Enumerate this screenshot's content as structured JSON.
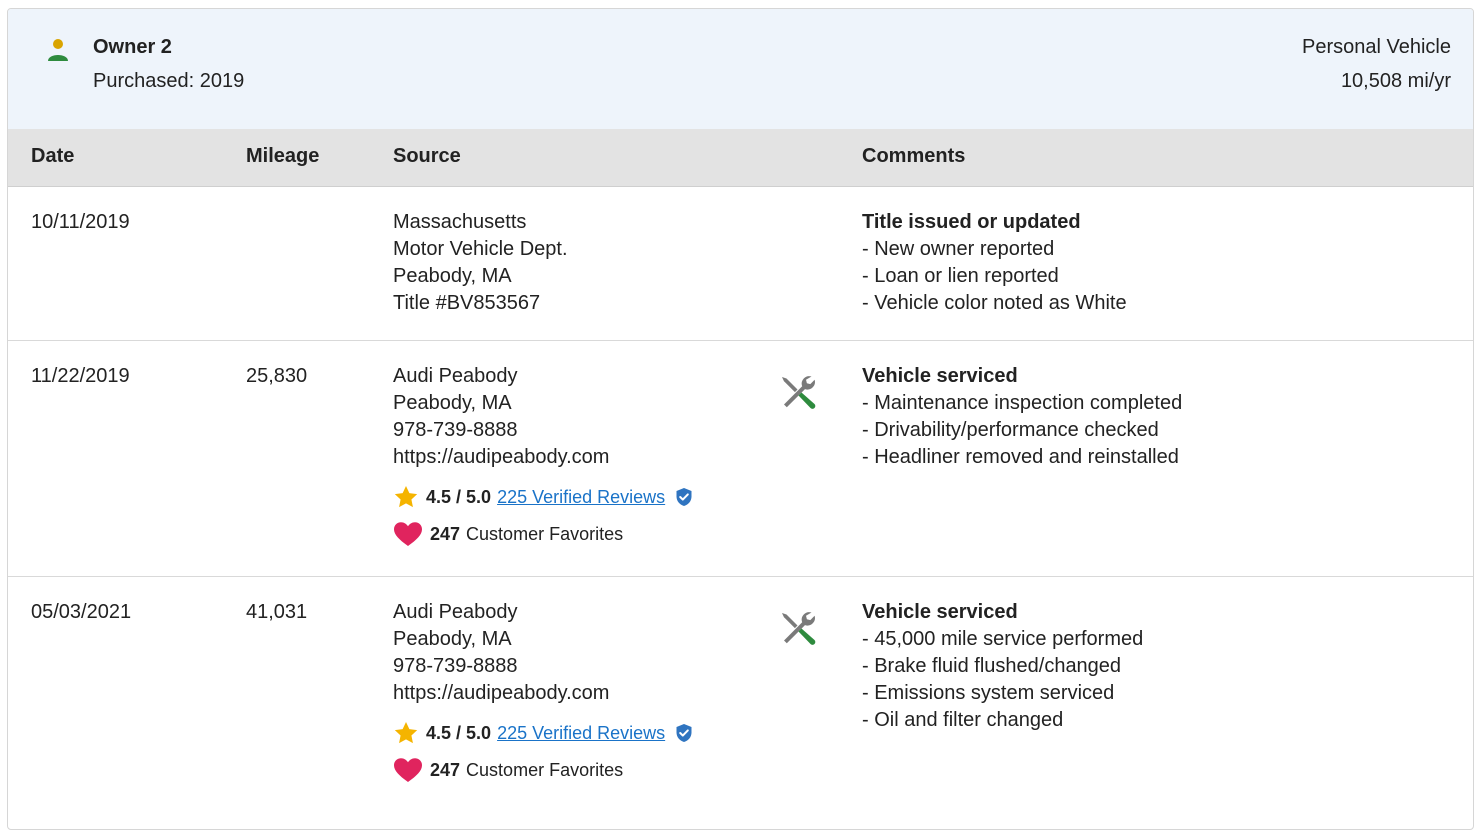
{
  "owner": {
    "name": "Owner 2",
    "purchased": "Purchased: 2019",
    "use_type": "Personal Vehicle",
    "miles_per_year": "10,508 mi/yr"
  },
  "columns": {
    "date": "Date",
    "mileage": "Mileage",
    "source": "Source",
    "comments": "Comments"
  },
  "records": [
    {
      "date": "10/11/2019",
      "mileage": "",
      "source": [
        "Massachusetts",
        "Motor Vehicle Dept.",
        "Peabody, MA",
        "Title #BV853567"
      ],
      "comment_title": "Title issued or updated",
      "comments": [
        "- New owner reported",
        "- Loan or lien reported",
        "- Vehicle color noted as White"
      ]
    },
    {
      "date": "11/22/2019",
      "mileage": "25,830",
      "source": [
        "Audi Peabody",
        "Peabody, MA",
        "978-739-8888",
        "https://audipeabody.com"
      ],
      "rating": "4.5 / 5.0",
      "reviews_link": "225 Verified Reviews",
      "favorites_count": "247",
      "favorites_label": "Customer Favorites",
      "comment_title": "Vehicle serviced",
      "comments": [
        "- Maintenance inspection completed",
        "- Drivability/performance checked",
        "- Headliner removed and reinstalled"
      ]
    },
    {
      "date": "05/03/2021",
      "mileage": "41,031",
      "source": [
        "Audi Peabody",
        "Peabody, MA",
        "978-739-8888",
        "https://audipeabody.com"
      ],
      "rating": "4.5 / 5.0",
      "reviews_link": "225 Verified Reviews",
      "favorites_count": "247",
      "favorites_label": "Customer Favorites",
      "comment_title": "Vehicle serviced",
      "comments": [
        "- 45,000 mile service performed",
        "- Brake fluid flushed/changed",
        "- Emissions system serviced",
        "- Oil and filter changed"
      ]
    }
  ],
  "icons": {
    "owner": "person-icon",
    "service": "wrench-screwdriver-icon",
    "rating": "star-icon",
    "verified": "verified-shield-icon",
    "favorites": "heart-icon"
  },
  "colors": {
    "header_bg": "#eef4fb",
    "table_head_bg": "#e3e3e3",
    "link": "#1a73c8",
    "star": "#f5b400",
    "heart": "#e0245e",
    "shield": "#2f74c0",
    "person_head": "#d9a400",
    "person_body": "#2e8b3e"
  }
}
